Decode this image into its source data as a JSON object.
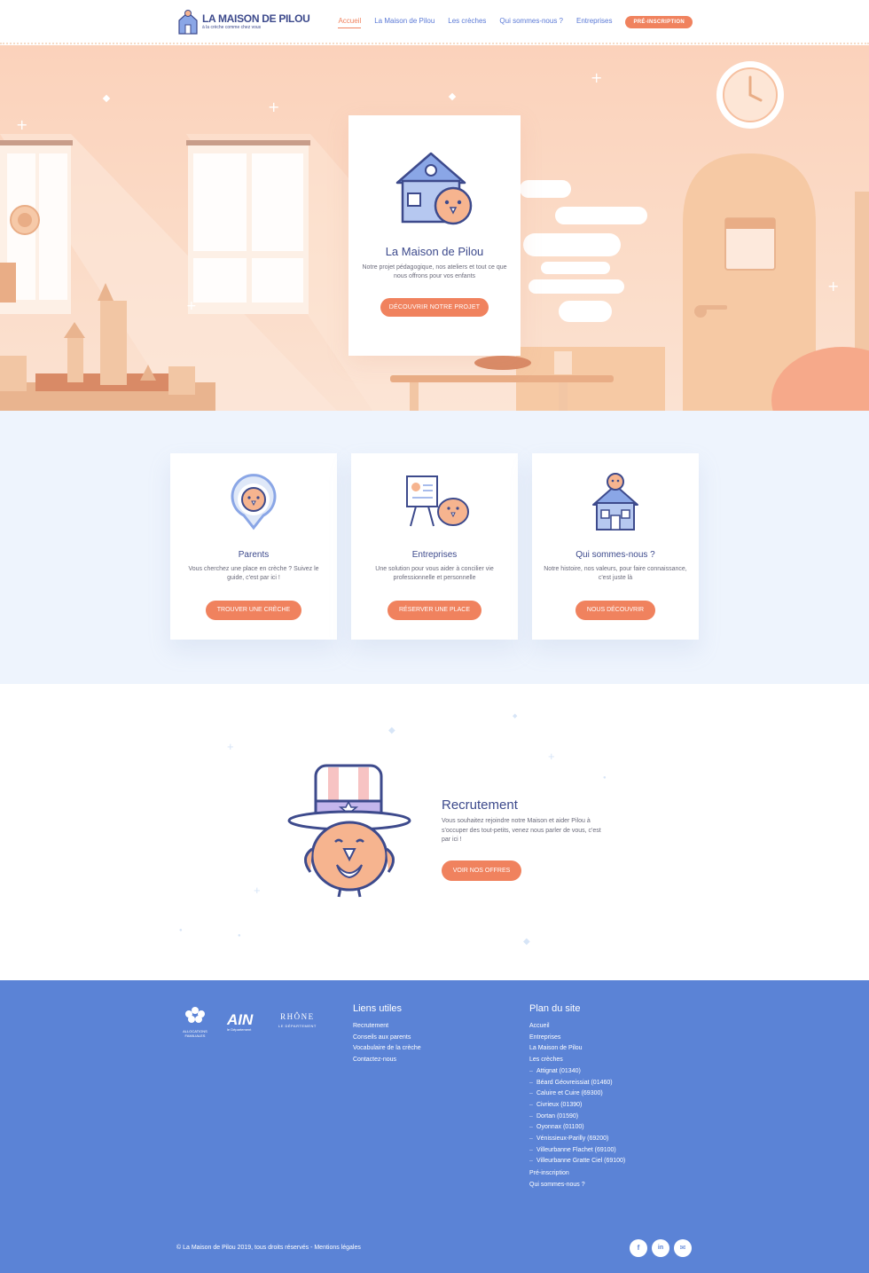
{
  "header": {
    "logo": {
      "title": "LA MAISON DE PILOU",
      "subtitle": "à la crèche comme chez vous"
    },
    "nav": [
      {
        "label": "Accueil",
        "active": true
      },
      {
        "label": "La Maison de Pilou",
        "active": false
      },
      {
        "label": "Les crèches",
        "active": false
      },
      {
        "label": "Qui sommes-nous ?",
        "active": false
      },
      {
        "label": "Entreprises",
        "active": false
      }
    ],
    "cta_label": "PRÉ-INSCRIPTION"
  },
  "hero": {
    "title": "La Maison de Pilou",
    "text": "Notre projet pédagogique, nos ateliers et tout ce que nous offrons pour vos enfants",
    "button_label": "DÉCOUVRIR NOTRE PROJET"
  },
  "cards": [
    {
      "title": "Parents",
      "text": "Vous cherchez une place en crèche ? Suivez le guide, c'est par ici !",
      "button_label": "TROUVER UNE CRÈCHE",
      "icon": "map-pin-bird-icon"
    },
    {
      "title": "Entreprises",
      "text": "Une solution pour vous aider à concilier vie professionnelle et personnelle",
      "button_label": "RÉSERVER UNE PLACE",
      "icon": "presentation-bird-icon"
    },
    {
      "title": "Qui sommes-nous ?",
      "text": "Notre histoire, nos valeurs, pour faire connaissance, c'est juste là",
      "button_label": "NOUS DÉCOUVRIR",
      "icon": "house-bird-icon"
    }
  ],
  "recruitment": {
    "title": "Recrutement",
    "text": "Vous souhaitez rejoindre notre Maison et aider Pilou à s'occuper des tout-petits, venez nous parler de vous, c'est par ici !",
    "button_label": "VOIR NOS OFFRES"
  },
  "footer": {
    "partners": [
      {
        "name": "ALLOCATIONS FAMILIALES",
        "icon": "caf-logo"
      },
      {
        "name": "AIN",
        "subtitle": "le Département",
        "icon": "ain-logo"
      },
      {
        "name": "RHÔNE",
        "subtitle": "LE DÉPARTEMENT",
        "icon": "rhone-logo"
      }
    ],
    "useful_links": {
      "title": "Liens utiles",
      "items": [
        "Recrutement",
        "Conseils aux parents",
        "Vocabulaire de la crèche",
        "Contactez-nous"
      ]
    },
    "sitemap": {
      "title": "Plan du site",
      "items": [
        {
          "label": "Accueil",
          "sub": false
        },
        {
          "label": "Entreprises",
          "sub": false
        },
        {
          "label": "La Maison de Pilou",
          "sub": false
        },
        {
          "label": "Les crèches",
          "sub": false
        },
        {
          "label": "Attignat (01340)",
          "sub": true
        },
        {
          "label": "Béard Géovreissiat (01460)",
          "sub": true
        },
        {
          "label": "Caluire et Cuire (69300)",
          "sub": true
        },
        {
          "label": "Civrieux (01390)",
          "sub": true
        },
        {
          "label": "Dortan (01590)",
          "sub": true
        },
        {
          "label": "Oyonnax (01100)",
          "sub": true
        },
        {
          "label": "Vénissieux-Parilly (69200)",
          "sub": true
        },
        {
          "label": "Villeurbanne Flachet (69100)",
          "sub": true
        },
        {
          "label": "Villeurbanne Gratte Ciel (69100)",
          "sub": true
        },
        {
          "label": "Pré-inscription",
          "sub": false
        },
        {
          "label": "Qui sommes-nous ?",
          "sub": false
        }
      ]
    },
    "copyright": "© La Maison de Pilou 2019, tous droits réservés - Mentions légales",
    "social": [
      {
        "icon": "facebook-icon",
        "glyph": "f"
      },
      {
        "icon": "linkedin-icon",
        "glyph": "in"
      },
      {
        "icon": "email-icon",
        "glyph": "✉"
      }
    ]
  },
  "colors": {
    "accent": "#f0825e",
    "navy": "#3d4a8c",
    "link": "#5a79d6",
    "footer": "#5b83d6",
    "hero_bg": "#fbd2bb",
    "cards_bg": "#eef4fd"
  }
}
